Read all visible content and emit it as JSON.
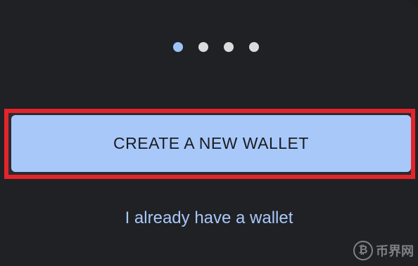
{
  "pagination": {
    "total": 4,
    "active_index": 0,
    "colors": {
      "active": "#9fc3f5",
      "inactive": "#dcdcdc"
    }
  },
  "primary_action": {
    "label": "CREATE A NEW WALLET",
    "color": "#a8c8fa",
    "highlight_color": "#e3242b"
  },
  "secondary_action": {
    "label": "I already have a wallet",
    "color": "#a8c8fa"
  },
  "watermark": {
    "logo_glyph": "₿",
    "text": "币界网"
  }
}
